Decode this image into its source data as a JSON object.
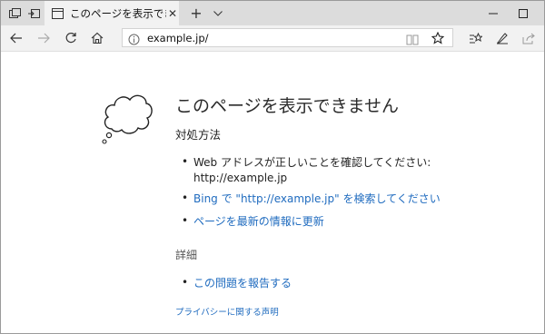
{
  "browser": {
    "tab": {
      "title": "このページを表示できません",
      "close_icon": "close-icon"
    },
    "address": {
      "url": "example.jp/"
    },
    "icons": {
      "tab_manager": "tab-manager-icon",
      "set_aside": "set-aside-tabs-icon",
      "page": "page-icon",
      "new_tab": "plus-icon",
      "tab_menu": "chevron-down-icon",
      "minimize": "minimize-icon",
      "maximize": "maximize-icon",
      "back": "arrow-left-icon",
      "forward": "arrow-right-icon",
      "refresh": "refresh-icon",
      "home": "home-icon",
      "info": "info-icon",
      "reading_view": "reading-view-icon",
      "favorite": "star-icon",
      "favorites_hub": "favorites-hub-icon",
      "notes": "pen-icon",
      "share": "share-icon"
    }
  },
  "page": {
    "heading": "このページを表示できません",
    "subheading": "対処方法",
    "tips": [
      {
        "line1": "Web アドレスが正しいことを確認してください:",
        "line2": "http://example.jp"
      },
      {
        "text": "Bing で \"http://example.jp\" を検索してください"
      },
      {
        "text": "ページを最新の情報に更新"
      }
    ],
    "details_heading": "詳細",
    "report_link": "この問題を報告する",
    "privacy_link": "プライバシーに関する声明"
  },
  "colors": {
    "link": "#1f6bbf",
    "tabbar": "#dcdcdc",
    "toolbar": "#f2f2f2"
  }
}
